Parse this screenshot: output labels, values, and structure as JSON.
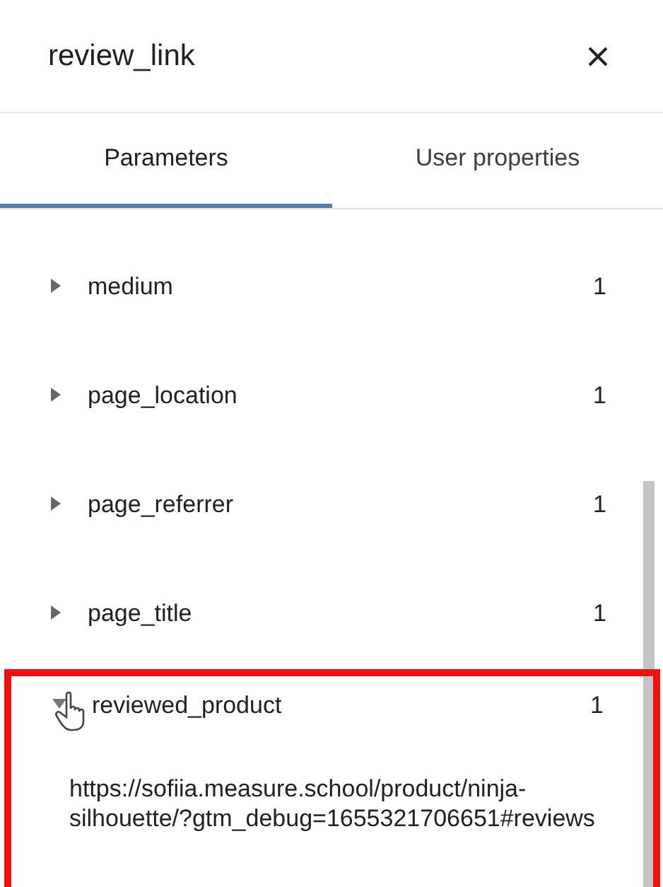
{
  "panel": {
    "title": "review_link"
  },
  "tabs": [
    {
      "label": "Parameters",
      "selected": true
    },
    {
      "label": "User properties",
      "selected": false
    }
  ],
  "parameters": [
    {
      "name": "medium",
      "count": "1",
      "expanded": false,
      "highlighted": false
    },
    {
      "name": "page_location",
      "count": "1",
      "expanded": false,
      "highlighted": false
    },
    {
      "name": "page_referrer",
      "count": "1",
      "expanded": false,
      "highlighted": false
    },
    {
      "name": "page_title",
      "count": "1",
      "expanded": false,
      "highlighted": false
    },
    {
      "name": "reviewed_product",
      "count": "1",
      "expanded": true,
      "highlighted": true,
      "value": "https://sofiia.measure.school/product/ninja-silhouette/?gtm_debug=1655321706651#reviews"
    }
  ]
}
